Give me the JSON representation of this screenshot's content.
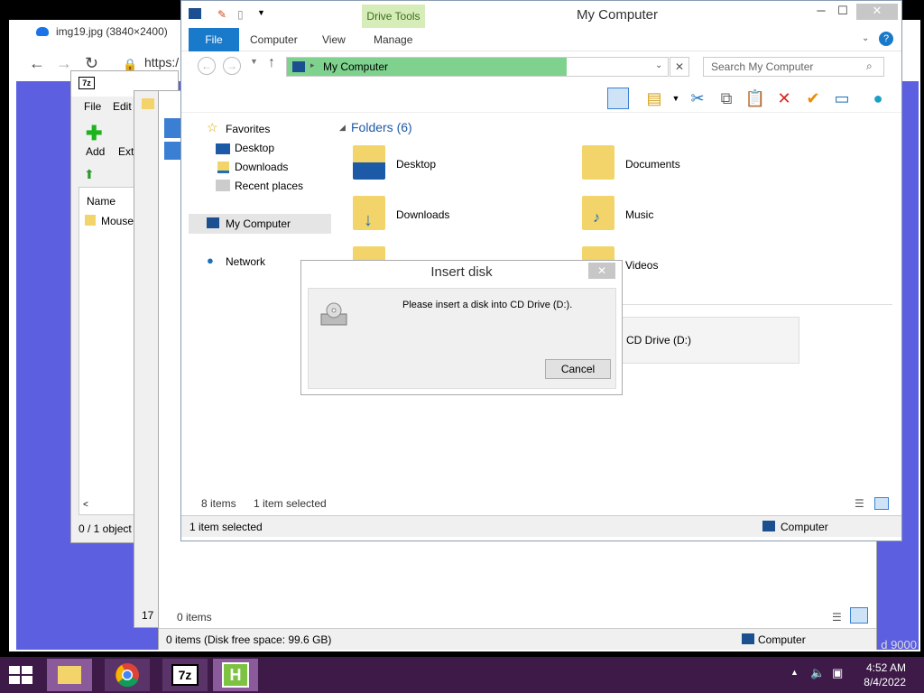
{
  "browser": {
    "tab_title": "img19.jpg (3840×2400)",
    "url_text": "https:/",
    "bottom_text": "d 9000"
  },
  "zip": {
    "logo": "7z",
    "menu_file": "File",
    "menu_edit": "Edit",
    "add_label": "Add",
    "extract_label": "Extr",
    "col_name": "Name",
    "row_item": "Mouse",
    "status": "0 / 1 object"
  },
  "mid_window": {
    "status": "17"
  },
  "bg_explorer": {
    "items": "0 items",
    "status": "0 items (Disk free space: 99.6 GB)",
    "computer": "Computer"
  },
  "explorer": {
    "title": "My Computer",
    "drive_tools": "Drive Tools",
    "tabs": [
      "File",
      "Computer",
      "View",
      "Manage"
    ],
    "address": "My Computer",
    "search_placeholder": "Search My Computer",
    "nav": {
      "favorites": "Favorites",
      "desktop": "Desktop",
      "downloads": "Downloads",
      "recent": "Recent places",
      "mycomputer": "My Computer",
      "network": "Network"
    },
    "folders_header": "Folders (6)",
    "folders": [
      "Desktop",
      "Documents",
      "Downloads",
      "Music",
      "Videos"
    ],
    "cd_drive": "CD Drive (D:)",
    "items_count": "8 items",
    "items_selected": "1 item selected",
    "status_left": "1 item selected",
    "status_right": "Computer"
  },
  "dialog": {
    "title": "Insert disk",
    "message": "Please insert a disk into CD Drive (D:).",
    "cancel": "Cancel"
  },
  "taskbar": {
    "time": "4:52 AM",
    "date": "8/4/2022"
  },
  "colors": {
    "accent": "#1979ca",
    "address_highlight": "#7ed28e",
    "taskbar": "#3d1a48",
    "browser_bg": "#5b5fe0"
  }
}
